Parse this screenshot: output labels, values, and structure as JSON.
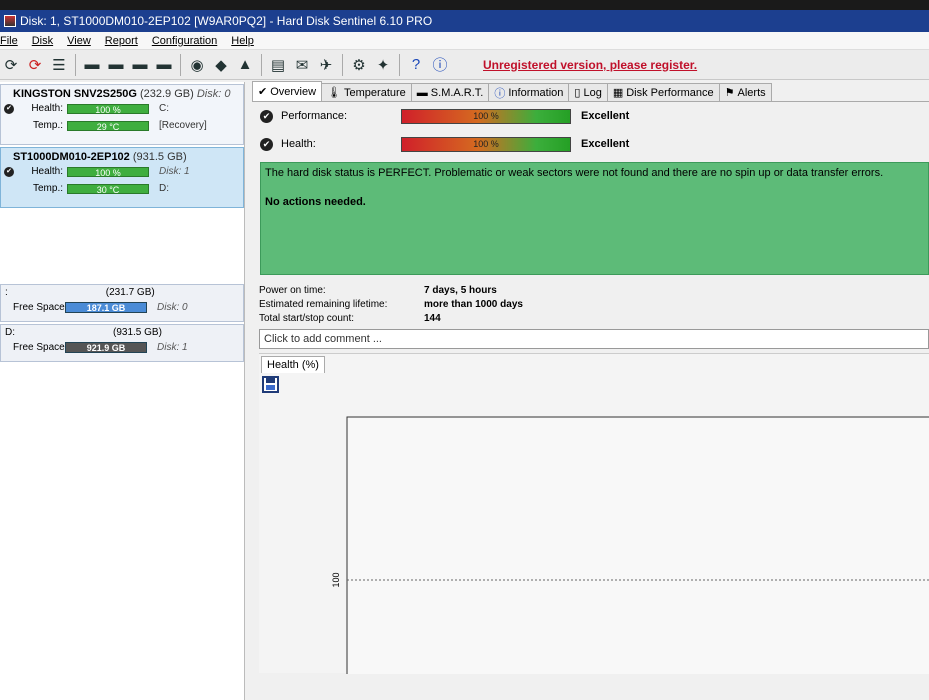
{
  "window": {
    "title": "Disk: 1, ST1000DM010-2EP102 [W9AR0PQ2]  -  Hard Disk Sentinel 6.10 PRO"
  },
  "menu": [
    "File",
    "Disk",
    "View",
    "Report",
    "Configuration",
    "Help"
  ],
  "toolbar": {
    "icons": [
      "refresh-icon",
      "refresh-disk-icon",
      "list-icon",
      "disk-test-icon",
      "surface-test-icon",
      "disk-scan-icon",
      "disk-erase-icon",
      "globe-icon",
      "network-disk-icon",
      "alert-disk-icon",
      "notes-icon",
      "email-icon",
      "send-report-icon",
      "settings-icon",
      "tools-icon",
      "help-icon",
      "info-icon"
    ],
    "unregistered": "Unregistered version, please register."
  },
  "disks": [
    {
      "name": "KINGSTON SNV2S250G",
      "size": "(232.9 GB)",
      "disk_label": "Disk: 0",
      "health_label": "Health:",
      "health_value": "100 %",
      "health_extra": "C:",
      "temp_label": "Temp.:",
      "temp_value": "29 °C",
      "temp_extra": "[Recovery]"
    },
    {
      "name": "ST1000DM010-2EP102",
      "size": "(931.5 GB)",
      "disk_label": "",
      "health_label": "Health:",
      "health_value": "100 %",
      "health_extra": "Disk: 1",
      "temp_label": "Temp.:",
      "temp_value": "30 °C",
      "temp_extra": "D:"
    }
  ],
  "volumes": [
    {
      "letter": ":",
      "size": "(231.7 GB)",
      "free_label": "Free Space",
      "free_value": "187.1 GB",
      "disk": "Disk: 0",
      "fill": 0.81
    },
    {
      "letter": "D:",
      "size": "(931.5 GB)",
      "free_label": "Free Space",
      "free_value": "921.9 GB",
      "disk": "Disk: 1",
      "fill": 0.99
    }
  ],
  "tabs": [
    {
      "icon": "check-icon",
      "label": "Overview"
    },
    {
      "icon": "thermometer-icon",
      "label": "Temperature"
    },
    {
      "icon": "smart-icon",
      "label": "S.M.A.R.T."
    },
    {
      "icon": "info-icon",
      "label": "Information"
    },
    {
      "icon": "log-icon",
      "label": "Log"
    },
    {
      "icon": "performance-icon",
      "label": "Disk Performance"
    },
    {
      "icon": "alerts-icon",
      "label": "Alerts"
    }
  ],
  "overview": {
    "performance_label": "Performance:",
    "performance_value": "100 %",
    "performance_verdict": "Excellent",
    "health_label": "Health:",
    "health_value": "100 %",
    "health_verdict": "Excellent",
    "status_text": "The hard disk status is PERFECT. Problematic or weak sectors were not found and there are no spin up or data transfer errors.",
    "action_text": "No actions needed.",
    "power_on_label": "Power on time:",
    "power_on_value": "7 days, 5 hours",
    "lifetime_label": "Estimated remaining lifetime:",
    "lifetime_value": "more than 1000 days",
    "startstop_label": "Total start/stop count:",
    "startstop_value": "144",
    "comment_placeholder": "Click to add comment ..."
  },
  "chart_tab": "Health (%)",
  "chart_data": {
    "type": "line",
    "title": "",
    "xlabel": "",
    "ylabel": "",
    "y_tick_labels": [
      "100"
    ],
    "series": [
      {
        "values": [
          100
        ]
      }
    ],
    "ylim": [
      0,
      100
    ]
  }
}
